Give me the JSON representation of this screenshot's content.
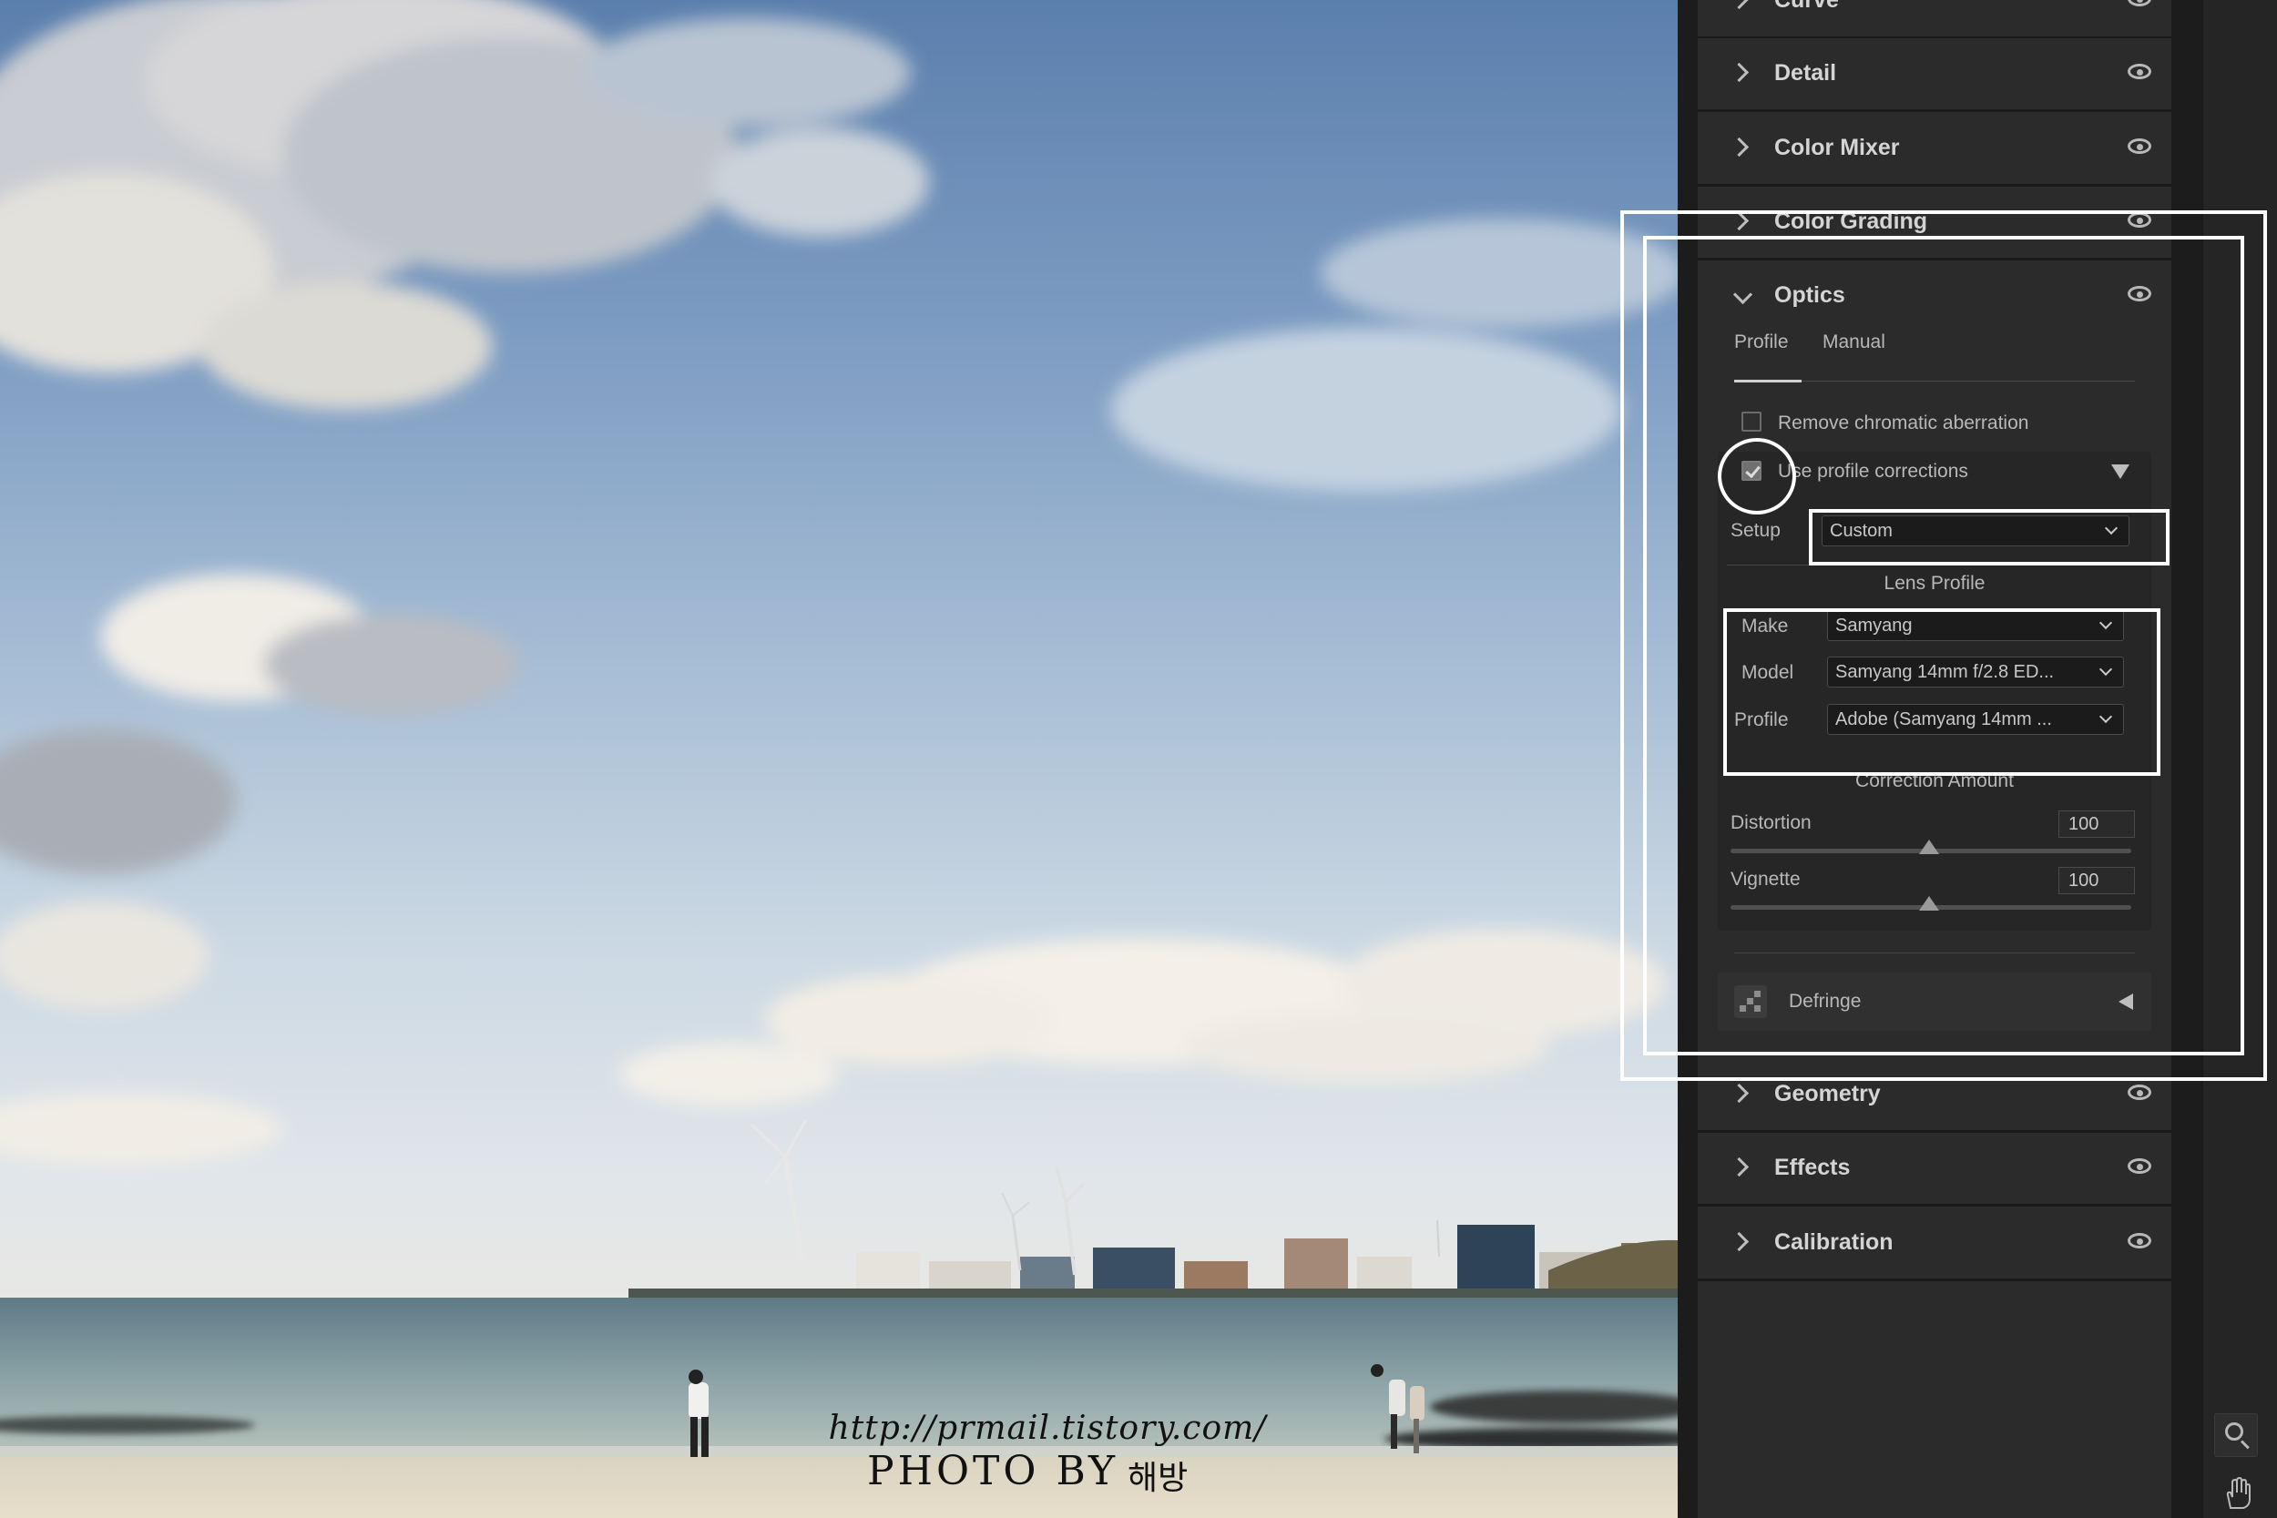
{
  "watermark": {
    "url": "http://prmail.tistory.com/",
    "photo_by": "PHOTO BY",
    "author": "해방"
  },
  "panel": {
    "sections_above": [
      {
        "label": "Curve"
      },
      {
        "label": "Detail"
      },
      {
        "label": "Color Mixer"
      },
      {
        "label": "Color Grading"
      }
    ],
    "optics": {
      "title": "Optics",
      "tabs": [
        {
          "label": "Profile",
          "active": true
        },
        {
          "label": "Manual",
          "active": false
        }
      ],
      "remove_ca": {
        "label": "Remove chromatic aberration",
        "checked": false
      },
      "use_profile": {
        "label": "Use profile corrections",
        "checked": true
      },
      "setup": {
        "label": "Setup",
        "value": "Custom"
      },
      "lens_profile": {
        "heading": "Lens Profile",
        "make": {
          "label": "Make",
          "value": "Samyang"
        },
        "model": {
          "label": "Model",
          "value": "Samyang 14mm f/2.8 ED..."
        },
        "profile": {
          "label": "Profile",
          "value": "Adobe (Samyang 14mm ..."
        }
      },
      "correction": {
        "heading": "Correction Amount",
        "distortion": {
          "label": "Distortion",
          "value": "100"
        },
        "vignette": {
          "label": "Vignette",
          "value": "100"
        }
      },
      "defringe": {
        "label": "Defringe"
      }
    },
    "sections_below": [
      {
        "label": "Geometry"
      },
      {
        "label": "Effects"
      },
      {
        "label": "Calibration"
      }
    ]
  },
  "tools": [
    {
      "icon": "zoom-icon"
    },
    {
      "icon": "hand-icon"
    }
  ],
  "colors": {
    "panel": "#2b2b2b",
    "panel_dark": "#1c1c1c",
    "annotation": "#ffffff"
  }
}
